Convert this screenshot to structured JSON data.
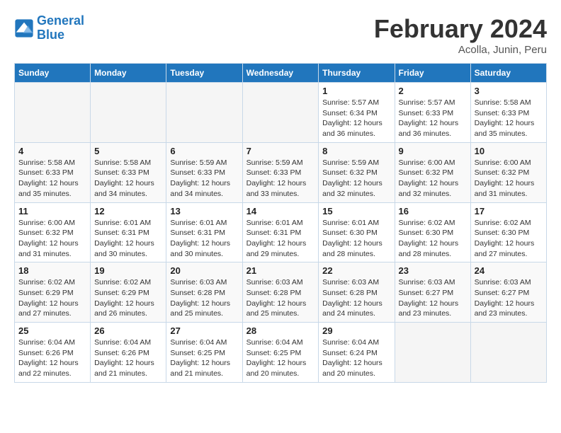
{
  "logo": {
    "line1": "General",
    "line2": "Blue"
  },
  "title": "February 2024",
  "location": "Acolla, Junin, Peru",
  "days_of_week": [
    "Sunday",
    "Monday",
    "Tuesday",
    "Wednesday",
    "Thursday",
    "Friday",
    "Saturday"
  ],
  "weeks": [
    [
      {
        "num": "",
        "info": ""
      },
      {
        "num": "",
        "info": ""
      },
      {
        "num": "",
        "info": ""
      },
      {
        "num": "",
        "info": ""
      },
      {
        "num": "1",
        "info": "Sunrise: 5:57 AM\nSunset: 6:34 PM\nDaylight: 12 hours and 36 minutes."
      },
      {
        "num": "2",
        "info": "Sunrise: 5:57 AM\nSunset: 6:33 PM\nDaylight: 12 hours and 36 minutes."
      },
      {
        "num": "3",
        "info": "Sunrise: 5:58 AM\nSunset: 6:33 PM\nDaylight: 12 hours and 35 minutes."
      }
    ],
    [
      {
        "num": "4",
        "info": "Sunrise: 5:58 AM\nSunset: 6:33 PM\nDaylight: 12 hours and 35 minutes."
      },
      {
        "num": "5",
        "info": "Sunrise: 5:58 AM\nSunset: 6:33 PM\nDaylight: 12 hours and 34 minutes."
      },
      {
        "num": "6",
        "info": "Sunrise: 5:59 AM\nSunset: 6:33 PM\nDaylight: 12 hours and 34 minutes."
      },
      {
        "num": "7",
        "info": "Sunrise: 5:59 AM\nSunset: 6:33 PM\nDaylight: 12 hours and 33 minutes."
      },
      {
        "num": "8",
        "info": "Sunrise: 5:59 AM\nSunset: 6:32 PM\nDaylight: 12 hours and 32 minutes."
      },
      {
        "num": "9",
        "info": "Sunrise: 6:00 AM\nSunset: 6:32 PM\nDaylight: 12 hours and 32 minutes."
      },
      {
        "num": "10",
        "info": "Sunrise: 6:00 AM\nSunset: 6:32 PM\nDaylight: 12 hours and 31 minutes."
      }
    ],
    [
      {
        "num": "11",
        "info": "Sunrise: 6:00 AM\nSunset: 6:32 PM\nDaylight: 12 hours and 31 minutes."
      },
      {
        "num": "12",
        "info": "Sunrise: 6:01 AM\nSunset: 6:31 PM\nDaylight: 12 hours and 30 minutes."
      },
      {
        "num": "13",
        "info": "Sunrise: 6:01 AM\nSunset: 6:31 PM\nDaylight: 12 hours and 30 minutes."
      },
      {
        "num": "14",
        "info": "Sunrise: 6:01 AM\nSunset: 6:31 PM\nDaylight: 12 hours and 29 minutes."
      },
      {
        "num": "15",
        "info": "Sunrise: 6:01 AM\nSunset: 6:30 PM\nDaylight: 12 hours and 28 minutes."
      },
      {
        "num": "16",
        "info": "Sunrise: 6:02 AM\nSunset: 6:30 PM\nDaylight: 12 hours and 28 minutes."
      },
      {
        "num": "17",
        "info": "Sunrise: 6:02 AM\nSunset: 6:30 PM\nDaylight: 12 hours and 27 minutes."
      }
    ],
    [
      {
        "num": "18",
        "info": "Sunrise: 6:02 AM\nSunset: 6:29 PM\nDaylight: 12 hours and 27 minutes."
      },
      {
        "num": "19",
        "info": "Sunrise: 6:02 AM\nSunset: 6:29 PM\nDaylight: 12 hours and 26 minutes."
      },
      {
        "num": "20",
        "info": "Sunrise: 6:03 AM\nSunset: 6:28 PM\nDaylight: 12 hours and 25 minutes."
      },
      {
        "num": "21",
        "info": "Sunrise: 6:03 AM\nSunset: 6:28 PM\nDaylight: 12 hours and 25 minutes."
      },
      {
        "num": "22",
        "info": "Sunrise: 6:03 AM\nSunset: 6:28 PM\nDaylight: 12 hours and 24 minutes."
      },
      {
        "num": "23",
        "info": "Sunrise: 6:03 AM\nSunset: 6:27 PM\nDaylight: 12 hours and 23 minutes."
      },
      {
        "num": "24",
        "info": "Sunrise: 6:03 AM\nSunset: 6:27 PM\nDaylight: 12 hours and 23 minutes."
      }
    ],
    [
      {
        "num": "25",
        "info": "Sunrise: 6:04 AM\nSunset: 6:26 PM\nDaylight: 12 hours and 22 minutes."
      },
      {
        "num": "26",
        "info": "Sunrise: 6:04 AM\nSunset: 6:26 PM\nDaylight: 12 hours and 21 minutes."
      },
      {
        "num": "27",
        "info": "Sunrise: 6:04 AM\nSunset: 6:25 PM\nDaylight: 12 hours and 21 minutes."
      },
      {
        "num": "28",
        "info": "Sunrise: 6:04 AM\nSunset: 6:25 PM\nDaylight: 12 hours and 20 minutes."
      },
      {
        "num": "29",
        "info": "Sunrise: 6:04 AM\nSunset: 6:24 PM\nDaylight: 12 hours and 20 minutes."
      },
      {
        "num": "",
        "info": ""
      },
      {
        "num": "",
        "info": ""
      }
    ]
  ]
}
